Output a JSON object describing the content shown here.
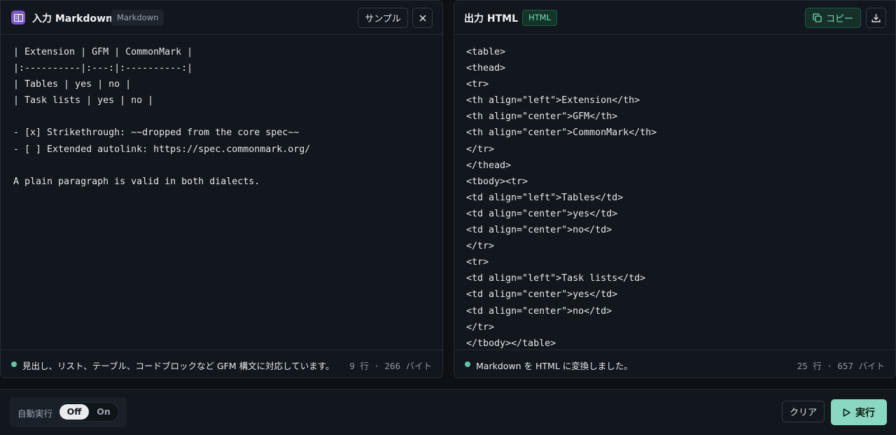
{
  "input_panel": {
    "title": "入力 Markdown",
    "badge": "Markdown",
    "sample_button": "サンプル",
    "close_icon": "close-icon",
    "lines": [
      "| Extension | GFM | CommonMark |",
      "|:----------|:---:|:----------:|",
      "| Tables | yes | no |",
      "| Task lists | yes | no |",
      "",
      "- [x] Strikethrough: ~~dropped from the core spec~~",
      "- [ ] Extended autolink: https://spec.commonmark.org/",
      "",
      "A plain paragraph is valid in both dialects."
    ],
    "status": "見出し、リスト、テーブル、コードブロックなど GFM 構文に対応しています。",
    "stats": "9 行 · 266 バイト"
  },
  "output_panel": {
    "title": "出力 HTML",
    "badge": "HTML",
    "copy_button": "コピー",
    "lines": [
      "<table>",
      "<thead>",
      "<tr>",
      "<th align=\"left\">Extension</th>",
      "<th align=\"center\">GFM</th>",
      "<th align=\"center\">CommonMark</th>",
      "</tr>",
      "</thead>",
      "<tbody><tr>",
      "<td align=\"left\">Tables</td>",
      "<td align=\"center\">yes</td>",
      "<td align=\"center\">no</td>",
      "</tr>",
      "<tr>",
      "<td align=\"left\">Task lists</td>",
      "<td align=\"center\">yes</td>",
      "<td align=\"center\">no</td>",
      "</tr>",
      "</tbody></table>"
    ],
    "status": "Markdown を HTML に変換しました。",
    "stats": "25 行 · 657 バイト"
  },
  "bottom_bar": {
    "auto_run_label": "自動実行",
    "toggle_off": "Off",
    "toggle_on": "On",
    "toggle_state": "Off",
    "clear_button": "クリア",
    "run_button": "実行"
  },
  "colors": {
    "accent": "#8ad7c2",
    "app_icon": "#7c5cc4",
    "status_dot": "#5fc7a6",
    "background": "#0d1116"
  }
}
